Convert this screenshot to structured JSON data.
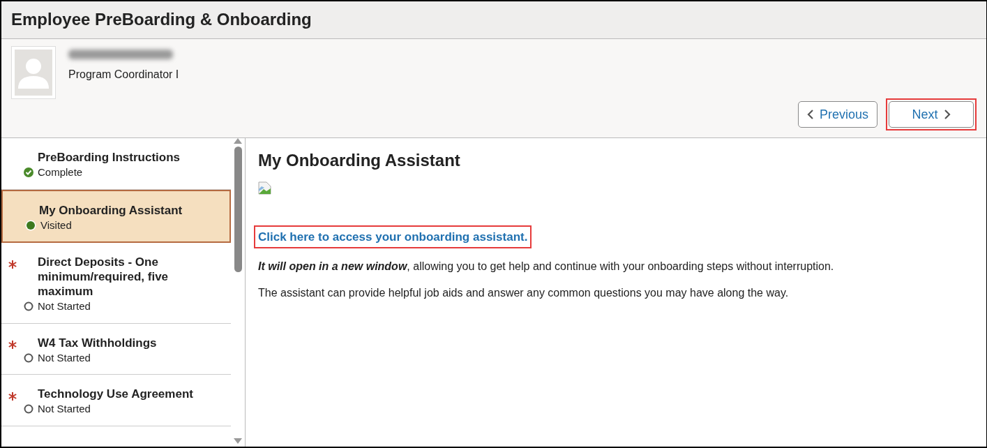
{
  "page_title": "Employee PreBoarding & Onboarding",
  "profile": {
    "job_title": "Program Coordinator I",
    "name_blurred": true
  },
  "nav_buttons": [
    {
      "label": "Previous",
      "kind": "prev",
      "highlighted": false
    },
    {
      "label": "Next",
      "kind": "next",
      "highlighted": true
    }
  ],
  "steps": [
    {
      "title": "PreBoarding Instructions",
      "status": "Complete",
      "kind": "complete",
      "required": false,
      "selected": false
    },
    {
      "title": "My Onboarding Assistant",
      "status": "Visited",
      "kind": "visited",
      "required": false,
      "selected": true
    },
    {
      "title": "Direct Deposits - One minimum/required, five maximum",
      "status": "Not Started",
      "kind": "not_started",
      "required": true,
      "selected": false
    },
    {
      "title": "W4 Tax Withholdings",
      "status": "Not Started",
      "kind": "not_started",
      "required": true,
      "selected": false
    },
    {
      "title": "Technology Use Agreement",
      "status": "Not Started",
      "kind": "not_started",
      "required": true,
      "selected": false
    }
  ],
  "content": {
    "heading": "My Onboarding Assistant",
    "broken_image": true,
    "link": {
      "text": "Click here to access your onboarding assistant.",
      "highlighted": true
    },
    "paragraphs": [
      {
        "emphasis": "It will open in a new window",
        "text": ", allowing you to get help and continue with your onboarding steps without interruption."
      },
      {
        "text": "The assistant can provide helpful job aids and answer any common questions you may have along the way."
      }
    ]
  }
}
